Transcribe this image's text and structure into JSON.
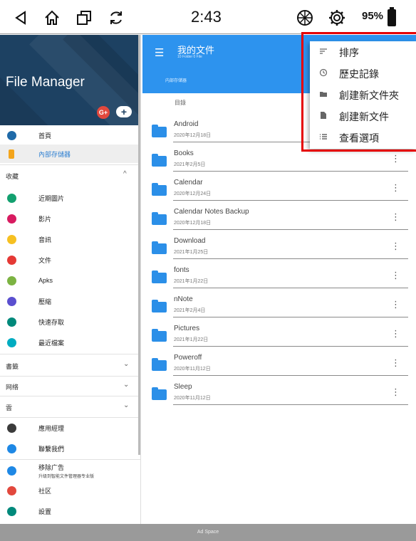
{
  "status_bar": {
    "time": "2:43",
    "battery": "95%",
    "icons": [
      "back-icon",
      "home-icon",
      "recent-apps-icon",
      "refresh-icon",
      "aperture-icon",
      "settings-icon",
      "battery-icon"
    ]
  },
  "drawer": {
    "title": "File Manager",
    "header_color": "#1d4162",
    "items": [
      {
        "label": "首頁",
        "icon": "home-icon",
        "color": "#1f6aa8"
      },
      {
        "label": "內部存儲器",
        "icon": "phone-icon",
        "color": "#f4a51c",
        "active": true
      }
    ],
    "sections": [
      {
        "label": "收藏",
        "chevron": "up",
        "items": [
          {
            "label": "近期圖片",
            "icon": "image-icon",
            "color": "#13a06f"
          },
          {
            "label": "影片",
            "icon": "video-icon",
            "color": "#d81b60"
          },
          {
            "label": "音訊",
            "icon": "headphone-icon",
            "color": "#f6c021"
          },
          {
            "label": "文件",
            "icon": "document-icon",
            "color": "#e53935"
          },
          {
            "label": "Apks",
            "icon": "android-icon",
            "color": "#7cb342"
          },
          {
            "label": "壓縮",
            "icon": "archive-icon",
            "color": "#5a4fcf"
          },
          {
            "label": "快速存取",
            "icon": "star-icon",
            "color": "#00897b"
          },
          {
            "label": "最近檔案",
            "icon": "history-icon",
            "color": "#00acc1"
          }
        ]
      },
      {
        "label": "書籤",
        "chevron": "down"
      },
      {
        "label": "网络",
        "chevron": "down"
      },
      {
        "label": "雲",
        "chevron": "down"
      }
    ],
    "bottom_items": [
      {
        "label": "應用經理",
        "icon": "apps-icon",
        "color": "#3b3b3b"
      },
      {
        "label": "聯繫我們",
        "icon": "contact-icon",
        "color": "#1e88e5"
      },
      {
        "label": "移除广告",
        "sub": "升级到智能文件管理器专业版",
        "icon": "crown-icon",
        "color": "#1e88e5"
      },
      {
        "label": "社区",
        "icon": "gplus-icon",
        "color": "#e2483d"
      },
      {
        "label": "設置",
        "icon": "settings-icon",
        "color": "#00897b"
      }
    ]
  },
  "main": {
    "title": "我的文件",
    "subtitle": "10 Folder 0 File",
    "breadcrumb": "内部存储器",
    "directory_label": "目錄",
    "accent": "#2d93ee",
    "files": [
      {
        "name": "Android",
        "date": "2020年12月18日"
      },
      {
        "name": "Books",
        "date": "2021年2月5日"
      },
      {
        "name": "Calendar",
        "date": "2020年12月24日"
      },
      {
        "name": "Calendar Notes Backup",
        "date": "2020年12月18日"
      },
      {
        "name": "Download",
        "date": "2021年1月25日"
      },
      {
        "name": "fonts",
        "date": "2021年1月22日"
      },
      {
        "name": "nNote",
        "date": "2021年2月4日"
      },
      {
        "name": "Pictures",
        "date": "2021年1月22日"
      },
      {
        "name": "Poweroff",
        "date": "2020年11月12日"
      },
      {
        "name": "Sleep",
        "date": "2020年11月12日"
      }
    ]
  },
  "popup_menu": {
    "items": [
      {
        "label": "排序",
        "icon": "sort-icon"
      },
      {
        "label": "歷史記錄",
        "icon": "history-icon"
      },
      {
        "label": "創建新文件夾",
        "icon": "folder-icon"
      },
      {
        "label": "創建新文件",
        "icon": "file-icon"
      },
      {
        "label": "查看選項",
        "icon": "list-icon"
      }
    ],
    "highlight_color": "#e50000"
  },
  "ad": "Ad Space"
}
